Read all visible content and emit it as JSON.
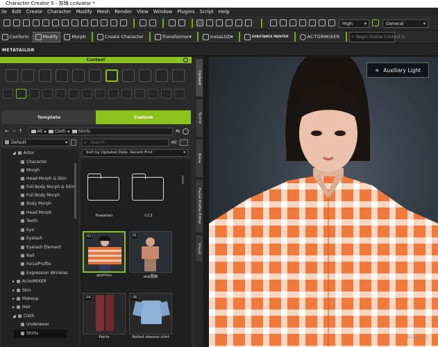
{
  "window": {
    "title": "Character Creator 5 - 苏琦.ccAvatar *"
  },
  "menu": [
    "ile",
    "Edit",
    "Create",
    "Character",
    "Modify",
    "Mesh",
    "Render",
    "View",
    "Window",
    "Plugins",
    "Script",
    "Help"
  ],
  "toolbar": {
    "quality": "High",
    "shading": "General",
    "search_placeholder": "Begin Online Content S"
  },
  "toolbar2": {
    "conform": "Conform",
    "modify": "Modify",
    "morph": "Morph",
    "create_character": "Create Character",
    "transformer": "Transformer",
    "instalod": "InstaLOD",
    "substance": "SUBSTANCE PAINTER",
    "actormixer": "ACTORMIXER"
  },
  "brand": "METATAILOR",
  "content": {
    "header": "Content",
    "tabs": {
      "template": "Template",
      "custom": "Custom"
    },
    "breadcrumb": [
      "All",
      "Cloth",
      "Shirts"
    ],
    "filter": "Default",
    "search_placeholder": "Search",
    "search_scope": "All",
    "sort": "Sort by Updated Date: Recent First"
  },
  "tree": [
    {
      "label": "Actor",
      "level": 1,
      "expanded": true
    },
    {
      "label": "Character",
      "level": 2
    },
    {
      "label": "Morph",
      "level": 2
    },
    {
      "label": "Head Morph & Skin",
      "level": 2
    },
    {
      "label": "Full Body Morph & Skin",
      "level": 2
    },
    {
      "label": "Full Body Morph",
      "level": 2
    },
    {
      "label": "Body Morph",
      "level": 2
    },
    {
      "label": "Head Morph",
      "level": 2
    },
    {
      "label": "Teeth",
      "level": 2
    },
    {
      "label": "Eye",
      "level": 2
    },
    {
      "label": "Eyelash",
      "level": 2
    },
    {
      "label": "Eyelash Element",
      "level": 2
    },
    {
      "label": "Nail",
      "level": 2
    },
    {
      "label": "FacialProfile",
      "level": 2
    },
    {
      "label": "Expression Wrinkles",
      "level": 2
    },
    {
      "label": "ActorMIXER",
      "level": 1
    },
    {
      "label": "Skin",
      "level": 1
    },
    {
      "label": "Makeup",
      "level": 1
    },
    {
      "label": "Hair",
      "level": 1
    },
    {
      "label": "Cloth",
      "level": 1,
      "expanded": true
    },
    {
      "label": "Underwear",
      "level": 2
    },
    {
      "label": "Shirts",
      "level": 2,
      "selected": true
    }
  ],
  "items": [
    {
      "label": "Hawaiian",
      "badge": "",
      "kind": "folder"
    },
    {
      "label": "CC3",
      "badge": "",
      "kind": "folder"
    },
    {
      "label": "gezitixu",
      "badge": "02",
      "kind": "avatar-plaid",
      "selected": true
    },
    {
      "label": "qiqi服装",
      "badge": "01",
      "kind": "avatar-child"
    },
    {
      "label": "Pants",
      "badge": "04",
      "kind": "pants"
    },
    {
      "label": "Rolled sleeves shirt",
      "badge": "06",
      "kind": "shirt"
    }
  ],
  "side_tabs": [
    "Content",
    "Scene",
    "Bone",
    "Facial Profile Editor",
    "Visual"
  ],
  "viewport": {
    "auxiliary_light": "Auxiliary Light",
    "watermark": "Build 0 1"
  },
  "colors": {
    "accent": "#8cc21c",
    "plaid_orange": "#f07a3c"
  }
}
